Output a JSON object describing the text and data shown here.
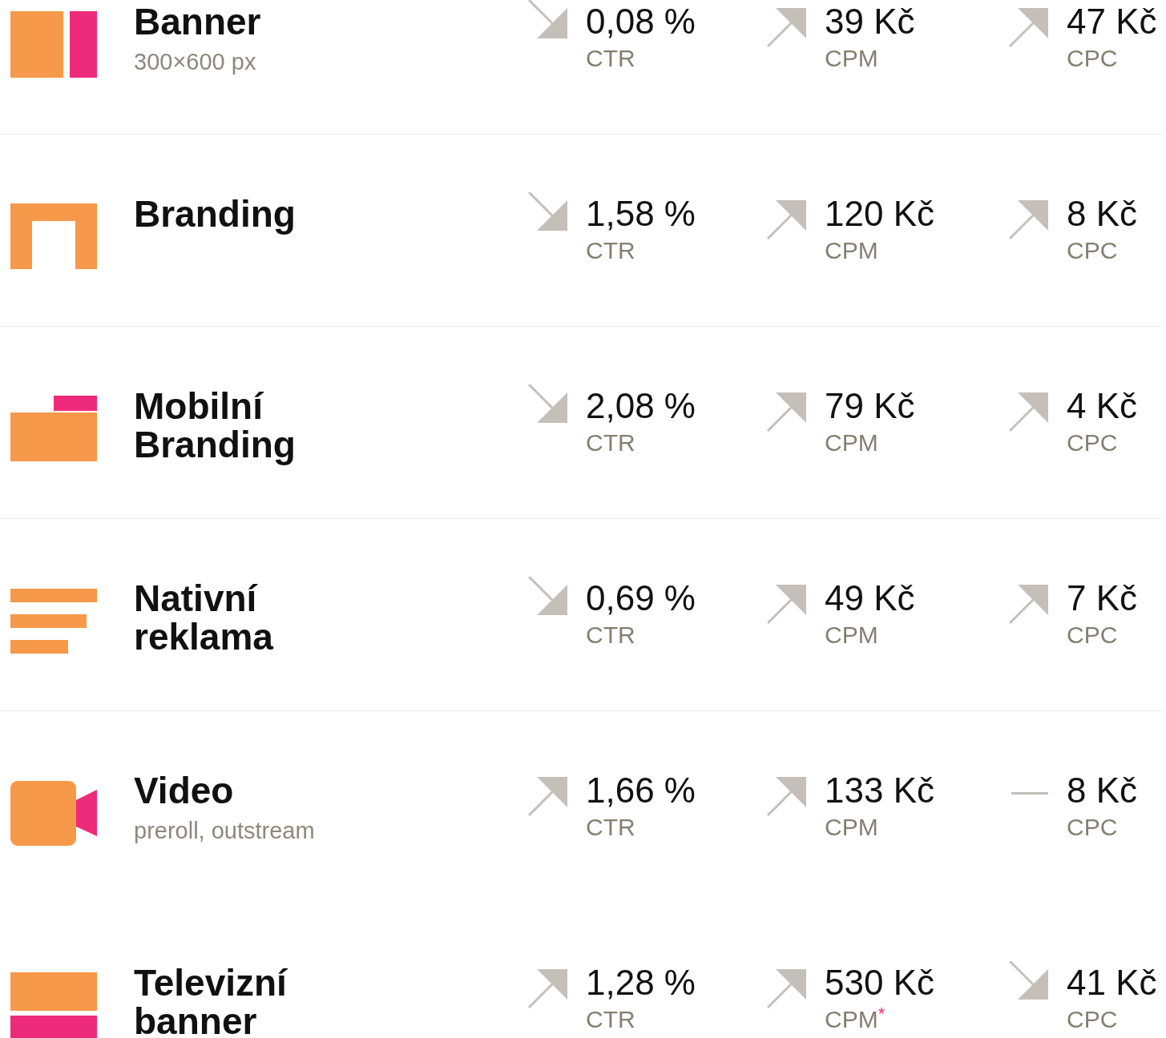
{
  "rows": [
    {
      "kind": "banner",
      "title": "Banner",
      "subtitle": "300×600 px",
      "divider_below": true,
      "metrics": [
        {
          "kind": "down",
          "value": "0,08 %",
          "label": "CTR"
        },
        {
          "kind": "up",
          "value": "39 Kč",
          "label": "CPM"
        },
        {
          "kind": "up",
          "value": "47 Kč",
          "label": "CPC"
        }
      ]
    },
    {
      "kind": "branding",
      "title": "Branding",
      "divider_below": true,
      "metrics": [
        {
          "kind": "down",
          "value": "1,58 %",
          "label": "CTR"
        },
        {
          "kind": "up",
          "value": "120 Kč",
          "label": "CPM"
        },
        {
          "kind": "up",
          "value": "8 Kč",
          "label": "CPC"
        }
      ]
    },
    {
      "kind": "mobile",
      "title": "Mobilní Branding",
      "divider_below": true,
      "metrics": [
        {
          "kind": "down",
          "value": "2,08 %",
          "label": "CTR"
        },
        {
          "kind": "up",
          "value": "79 Kč",
          "label": "CPM"
        },
        {
          "kind": "up",
          "value": "4 Kč",
          "label": "CPC"
        }
      ]
    },
    {
      "kind": "native",
      "title": "Nativní reklama",
      "divider_below": true,
      "metrics": [
        {
          "kind": "down",
          "value": "0,69 %",
          "label": "CTR"
        },
        {
          "kind": "up",
          "value": "49 Kč",
          "label": "CPM"
        },
        {
          "kind": "up",
          "value": "7 Kč",
          "label": "CPC"
        }
      ]
    },
    {
      "kind": "video",
      "title": "Video",
      "subtitle": "preroll, outstream",
      "divider_below": false,
      "metrics": [
        {
          "kind": "up",
          "value": "1,66 %",
          "label": "CTR"
        },
        {
          "kind": "up",
          "value": "133 Kč",
          "label": "CPM"
        },
        {
          "kind": "flat",
          "value": "8 Kč",
          "label": "CPC"
        }
      ]
    },
    {
      "kind": "tv",
      "title": "Televizní banner",
      "metrics": [
        {
          "kind": "up",
          "value": "1,28 %",
          "label": "CTR"
        },
        {
          "kind": "up",
          "value": "530 Kč",
          "label": "CPM",
          "footnote": "*"
        },
        {
          "kind": "down",
          "value": "41 Kč",
          "label": "CPC"
        }
      ]
    }
  ]
}
